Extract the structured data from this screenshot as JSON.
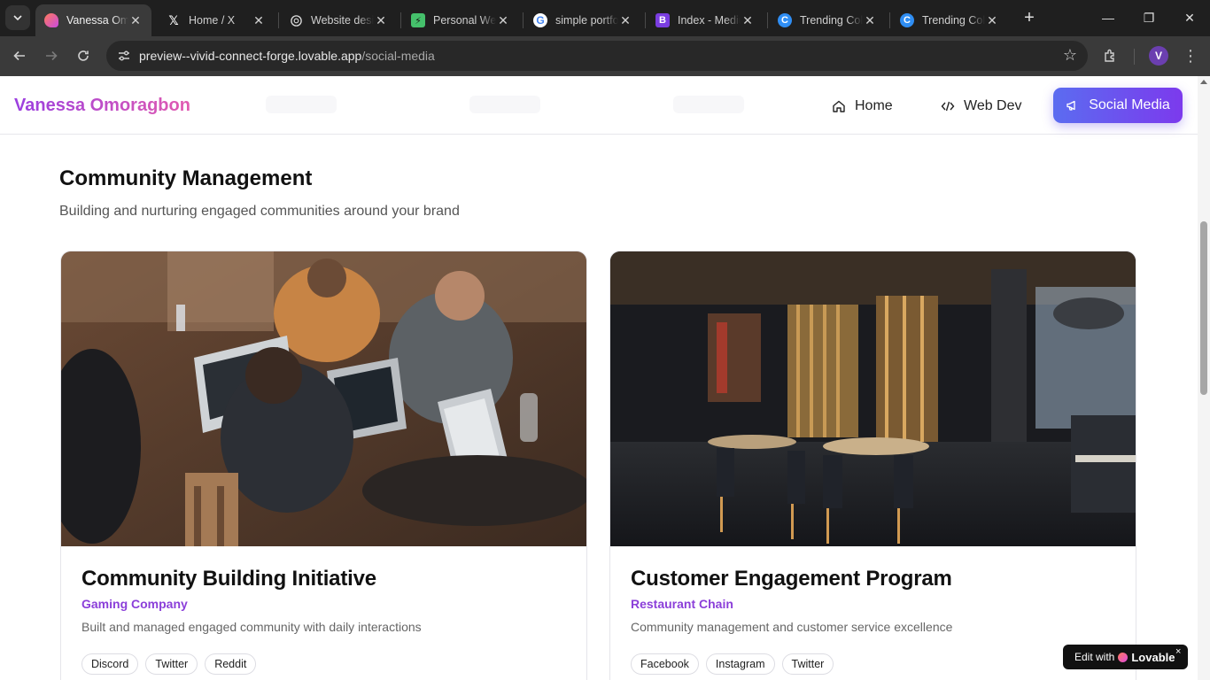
{
  "browser": {
    "tabs": [
      {
        "title": "Vanessa Omoragbon",
        "icon": "lovable-icon",
        "active": true
      },
      {
        "title": "Home / X",
        "icon": "x-icon"
      },
      {
        "title": "Website design",
        "icon": "openai-icon"
      },
      {
        "title": "Personal Website",
        "icon": "green-app-icon"
      },
      {
        "title": "simple portfolio",
        "icon": "google-icon"
      },
      {
        "title": "Index - Medium",
        "icon": "bootstrap-icon"
      },
      {
        "title": "Trending Colors",
        "icon": "refresh-c-icon"
      },
      {
        "title": "Trending Colors",
        "icon": "refresh-c-icon"
      }
    ],
    "url_host": "preview--vivid-connect-forge.lovable.app",
    "url_path": "/social-media",
    "profile_initial": "V"
  },
  "site": {
    "brand": "Vanessa Omoragbon",
    "nav": {
      "home": "Home",
      "web_dev": "Web Dev",
      "social_media": "Social Media"
    }
  },
  "section": {
    "title": "Community Management",
    "subtitle": "Building and nurturing engaged communities around your brand"
  },
  "cards": [
    {
      "title": "Community Building Initiative",
      "client": "Gaming Company",
      "description": "Built and managed engaged community with daily interactions",
      "tags": [
        "Discord",
        "Twitter",
        "Reddit"
      ]
    },
    {
      "title": "Customer Engagement Program",
      "client": "Restaurant Chain",
      "description": "Community management and customer service excellence",
      "tags": [
        "Facebook",
        "Instagram",
        "Twitter"
      ]
    }
  ],
  "badge": {
    "edit_with": "Edit with",
    "brand": "Lovable",
    "close": "×"
  },
  "colors": {
    "accent_purple": "#7c3aed",
    "accent_blue": "#5b6cf0",
    "client_purple": "#8b3fd9"
  }
}
